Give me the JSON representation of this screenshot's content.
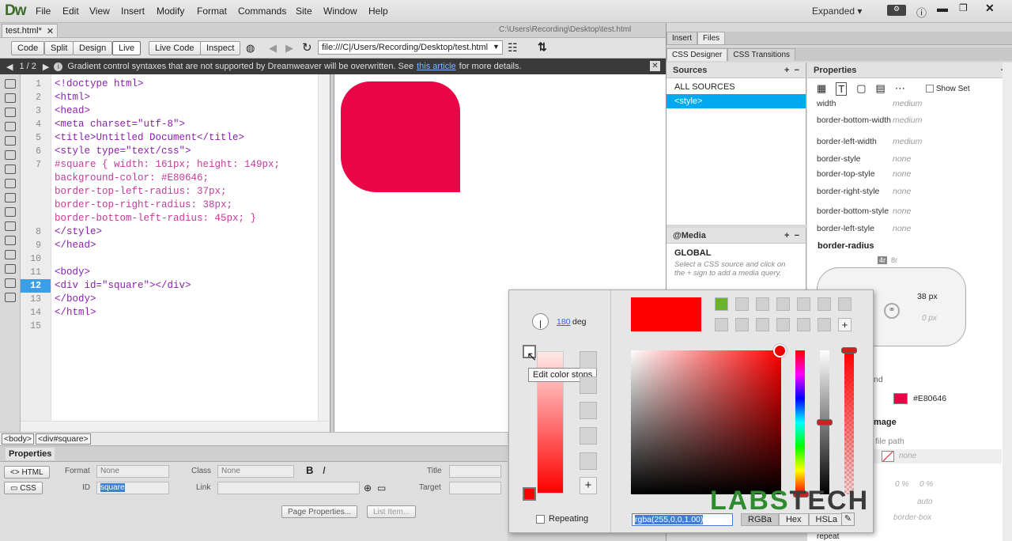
{
  "app": {
    "logo": "Dw",
    "workspace": "Expanded"
  },
  "menu": [
    "File",
    "Edit",
    "View",
    "Insert",
    "Modify",
    "Format",
    "Commands",
    "Site",
    "Window",
    "Help"
  ],
  "doc": {
    "tab": "test.html*",
    "path": "C:\\Users\\Recording\\Desktop\\test.html"
  },
  "toolbar": {
    "code": "Code",
    "split": "Split",
    "design": "Design",
    "live": "Live",
    "live_code": "Live Code",
    "inspect": "Inspect",
    "url": "file:///C|/Users/Recording/Desktop/test.html"
  },
  "infobar": {
    "count": "1 / 2",
    "message": "Gradient control syntaxes that are not supported by Dreamweaver will be overwritten. See",
    "link": "this article",
    "suffix": "for more details."
  },
  "code": {
    "line_numbers": [
      "1",
      "2",
      "3",
      "4",
      "5",
      "6",
      "7",
      "",
      "",
      "",
      "",
      "8",
      "9",
      "10",
      "11",
      "12",
      "13",
      "14",
      "15"
    ],
    "current_line": "12",
    "lines": [
      {
        "t": "<!doctype html>",
        "c": "tag"
      },
      {
        "t": "<html>",
        "c": "tag"
      },
      {
        "t": "<head>",
        "c": "tag"
      },
      {
        "t": "<meta charset=\"utf-8\">",
        "c": "tag"
      },
      {
        "t": "<title>Untitled Document</title>",
        "c": "tag"
      },
      {
        "t": "<style type=\"text/css\">",
        "c": "tag"
      },
      {
        "t": "#square { width: 161px; height: 149px;",
        "c": "css"
      },
      {
        "t": "background-color: #E80646;",
        "c": "css"
      },
      {
        "t": "border-top-left-radius: 37px;",
        "c": "css"
      },
      {
        "t": "border-top-right-radius: 38px;",
        "c": "css"
      },
      {
        "t": "border-bottom-left-radius: 45px; }",
        "c": "css"
      },
      {
        "t": "</style>",
        "c": "tag"
      },
      {
        "t": "</head>",
        "c": "tag"
      },
      {
        "t": "",
        "c": "tag"
      },
      {
        "t": "<body>",
        "c": "tag"
      },
      {
        "t": "<div id=\"square\"></div>",
        "c": "tag"
      },
      {
        "t": "</body>",
        "c": "tag"
      },
      {
        "t": "</html>",
        "c": "tag"
      },
      {
        "t": "",
        "c": "tag"
      }
    ]
  },
  "preview": {
    "color": "#E80646"
  },
  "tag_selector": [
    "<body>",
    "<div#square>"
  ],
  "properties": {
    "title": "Properties",
    "html": "HTML",
    "css": "CSS",
    "format_label": "Format",
    "format_value": "None",
    "class_label": "Class",
    "class_value": "None",
    "id_label": "ID",
    "id_value": "square",
    "link_label": "Link",
    "title_label": "Title",
    "target_label": "Target",
    "page_properties": "Page Properties...",
    "list_item": "List Item..."
  },
  "right_tabs": {
    "insert": "Insert",
    "files": "Files",
    "css_designer": "CSS Designer",
    "css_transitions": "CSS Transitions"
  },
  "sources": {
    "title": "Sources",
    "items": [
      "ALL SOURCES",
      "<style>"
    ]
  },
  "media": {
    "title": "@Media",
    "global": "GLOBAL",
    "hint": "Select a CSS source and click on the + sign to add a media query."
  },
  "props_panel": {
    "title": "Properties",
    "show_set": "Show Set",
    "rows": [
      {
        "k": "width",
        "v": "medium"
      },
      {
        "k": "border-bottom-width",
        "v": "medium"
      },
      {
        "k": "border-left-width",
        "v": "medium"
      },
      {
        "k": "border-style",
        "v": "none"
      },
      {
        "k": "border-top-style",
        "v": "none"
      },
      {
        "k": "border-right-style",
        "v": "none"
      },
      {
        "k": "border-bottom-style",
        "v": "none"
      },
      {
        "k": "border-left-style",
        "v": "none"
      }
    ],
    "border_radius": "border-radius",
    "radius_tab_4r": "4r",
    "radius_tab_8r": "8r",
    "radius_tr": "38 px",
    "radius_br": "0 px",
    "bg_label_partial": "nd",
    "bg_color": "#E80646",
    "image_partial": "mage",
    "file_path_partial": "file path",
    "none": "none",
    "pct1": "0 %",
    "pct2": "0 %",
    "auto": "auto",
    "border_box": "border-box",
    "repeat": "repeat"
  },
  "picker": {
    "angle": "180",
    "deg": "deg",
    "repeating": "Repeating",
    "tooltip": "Edit color stops",
    "value": "rgba(255,0,0,1.00)",
    "modes": [
      "RGBa",
      "Hex",
      "HSLa"
    ],
    "color": "#FF0000",
    "swatch_green": "#6AB42D"
  },
  "watermark": {
    "labs": "LABS",
    "tech": "TECH"
  }
}
